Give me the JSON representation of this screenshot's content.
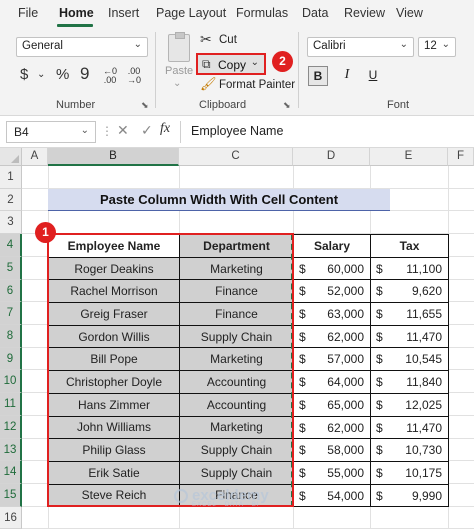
{
  "menu": {
    "tabs": [
      "File",
      "Home",
      "Insert",
      "Page Layout",
      "Formulas",
      "Data",
      "Review",
      "View"
    ],
    "active": "Home"
  },
  "ribbon": {
    "number_format": "General",
    "currency_symbol": "$",
    "percent_symbol": "%",
    "comma_symbol": "9",
    "dec_inc": "←0 .00",
    "dec_dec": ".00 →0",
    "number_group": "Number",
    "paste_label": "Paste",
    "cut_label": "Cut",
    "copy_label": "Copy",
    "format_painter_label": "Format Painter",
    "clipboard_group": "Clipboard",
    "font_name": "Calibri",
    "font_size": "12",
    "font_group": "Font",
    "bold_label": "B",
    "italic_label": "I",
    "underline_label": "U",
    "copy_badge": "2"
  },
  "formula_bar": {
    "name_box": "B4",
    "content": "Employee Name",
    "fx": "fx",
    "cancel": "✕",
    "enter": "✓"
  },
  "sheet": {
    "columns": [
      "A",
      "B",
      "C",
      "D",
      "E",
      "F"
    ],
    "rows": [
      "1",
      "2",
      "3",
      "4",
      "5",
      "6",
      "7",
      "8",
      "9",
      "10",
      "11",
      "12",
      "13",
      "14",
      "15",
      "16"
    ],
    "title": "Paste Column Width With Cell Content",
    "selection_badge": "1",
    "headers": {
      "name": "Employee Name",
      "department": "Department",
      "salary": "Salary",
      "tax": "Tax"
    },
    "currency": "$",
    "employees": [
      {
        "name": "Roger Deakins",
        "department": "Marketing",
        "salary": "60,000",
        "tax": "11,100"
      },
      {
        "name": "Rachel Morrison",
        "department": "Finance",
        "salary": "52,000",
        "tax": "9,620"
      },
      {
        "name": "Greig Fraser",
        "department": "Finance",
        "salary": "63,000",
        "tax": "11,655"
      },
      {
        "name": "Gordon Willis",
        "department": "Supply Chain",
        "salary": "62,000",
        "tax": "11,470"
      },
      {
        "name": "Bill Pope",
        "department": "Marketing",
        "salary": "57,000",
        "tax": "10,545"
      },
      {
        "name": "Christopher Doyle",
        "department": "Accounting",
        "salary": "64,000",
        "tax": "11,840"
      },
      {
        "name": "Hans Zimmer",
        "department": "Accounting",
        "salary": "65,000",
        "tax": "12,025"
      },
      {
        "name": "John Williams",
        "department": "Marketing",
        "salary": "62,000",
        "tax": "11,470"
      },
      {
        "name": "Philip Glass",
        "department": "Supply Chain",
        "salary": "58,000",
        "tax": "10,730"
      },
      {
        "name": "Erik Satie",
        "department": "Supply Chain",
        "salary": "55,000",
        "tax": "10,175"
      },
      {
        "name": "Steve Reich",
        "department": "Finance",
        "salary": "54,000",
        "tax": "9,990"
      }
    ]
  },
  "watermark": {
    "brand": "exceldemy",
    "tagline": "EXCEL · DATA · BI"
  }
}
